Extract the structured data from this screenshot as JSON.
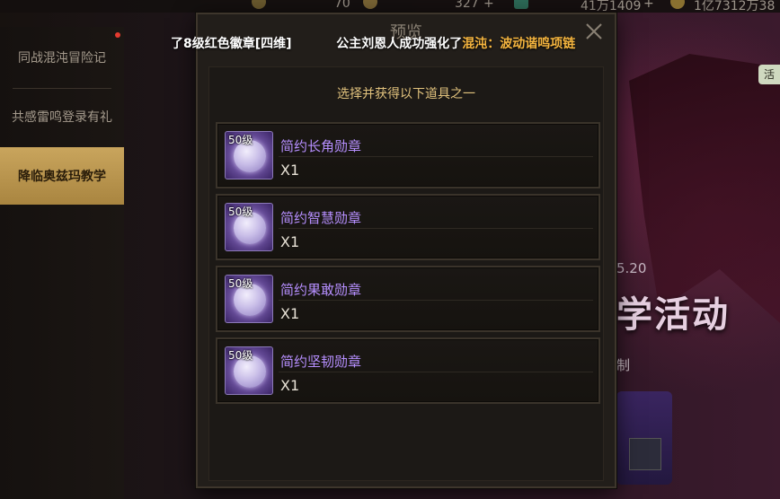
{
  "topbar": {
    "values": [
      "70",
      "327",
      "41万1409",
      "1亿7312万38"
    ],
    "plus_symbol": "+"
  },
  "sidebar": {
    "items": [
      {
        "label": "同战混沌冒险记",
        "active": false,
        "has_badge": true
      },
      {
        "label": "共感雷鸣登录有礼",
        "active": false,
        "has_badge": false
      },
      {
        "label": "降临奥兹玛教学",
        "active": true,
        "has_badge": false
      }
    ]
  },
  "background": {
    "date_fragment": "5.20",
    "banner_text": "学活动",
    "sub_text": "制",
    "tag_text": "活"
  },
  "marquee": {
    "part1": "了8级红色徽章[四维]",
    "part2": "公主刘恩人成功强化了",
    "highlight": "混沌：波动谐鸣项链"
  },
  "dialog": {
    "title": "预览",
    "subtitle": "选择并获得以下道具之一",
    "items": [
      {
        "level": "50级",
        "name": "简约长角勋章",
        "qty": "X1"
      },
      {
        "level": "50级",
        "name": "简约智慧勋章",
        "qty": "X1"
      },
      {
        "level": "50级",
        "name": "简约果敢勋章",
        "qty": "X1"
      },
      {
        "level": "50级",
        "name": "简约坚韧勋章",
        "qty": "X1"
      }
    ]
  },
  "colors": {
    "item_name": "#b68fff",
    "subtitle": "#e1c27d",
    "highlight": "#f5b53f",
    "active_tab": "#c9a55d"
  }
}
